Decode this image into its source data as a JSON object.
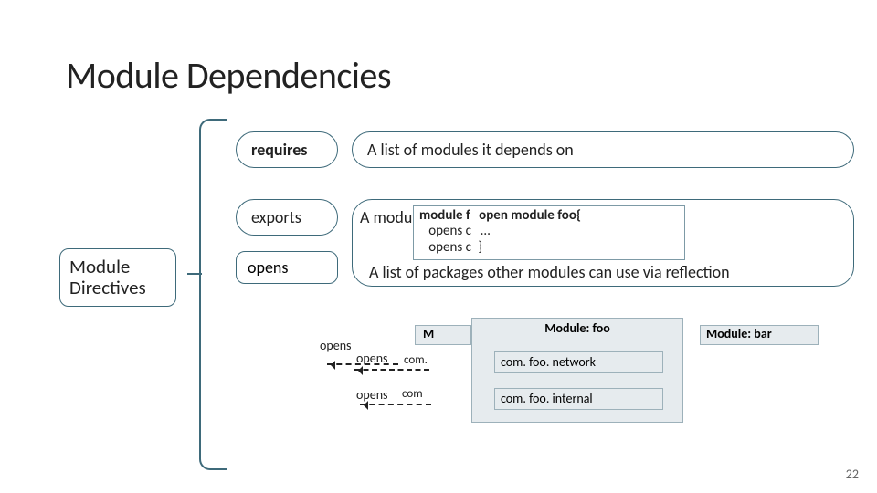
{
  "title": "Module Dependencies",
  "page_number": "22",
  "module_directives_label_l1": "Module",
  "module_directives_label_l2": "Directives",
  "requires": {
    "label": "requires",
    "desc": "A list of modules it depends on"
  },
  "exports": {
    "label": "exports"
  },
  "opens": {
    "label": "opens",
    "desc": "A list of packages other modules can use via reflection",
    "code_pre": "A module f",
    "code_l1a": "module f",
    "code_l1b": "open module foo{",
    "code_l2a": "opens c",
    "code_l2b": "…",
    "code_l3a": "opens c",
    "code_l3b": "}"
  },
  "diagram": {
    "m_label": "M",
    "foo_label": "Module: foo",
    "bar_label": "Module: bar",
    "opens1": "opens",
    "opens2": "opens",
    "opens3": "opens",
    "com1": "com.",
    "com2": "com",
    "pkg_network": "com. foo. network",
    "pkg_internal": "com. foo. internal"
  }
}
